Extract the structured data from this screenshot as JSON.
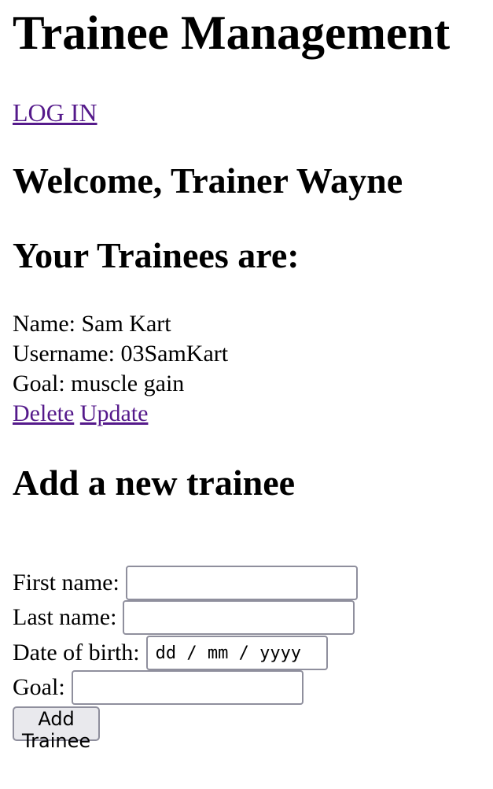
{
  "header": {
    "title": "Trainee Management",
    "login_link": "LOG IN"
  },
  "welcome": {
    "text": "Welcome, Trainer Wayne"
  },
  "trainees": {
    "heading": "Your Trainees are:",
    "items": [
      {
        "name_line": "Name: Sam Kart",
        "username_line": "Username: 03SamKart",
        "goal_line": "Goal: muscle gain",
        "delete_label": "Delete",
        "update_label": "Update"
      }
    ]
  },
  "add_form": {
    "heading": "Add a new trainee",
    "first_name_label": "First name:",
    "first_name_value": "",
    "last_name_label": "Last name:",
    "last_name_value": "",
    "dob_label": "Date of birth:",
    "dob_placeholder": "dd / mm / yyyy",
    "goal_label": "Goal:",
    "goal_value": "",
    "submit_label": "Add Trainee"
  },
  "colors": {
    "link_visited": "#551a8b",
    "input_border": "#8f8f9d",
    "button_bg": "#e9e9ed"
  }
}
